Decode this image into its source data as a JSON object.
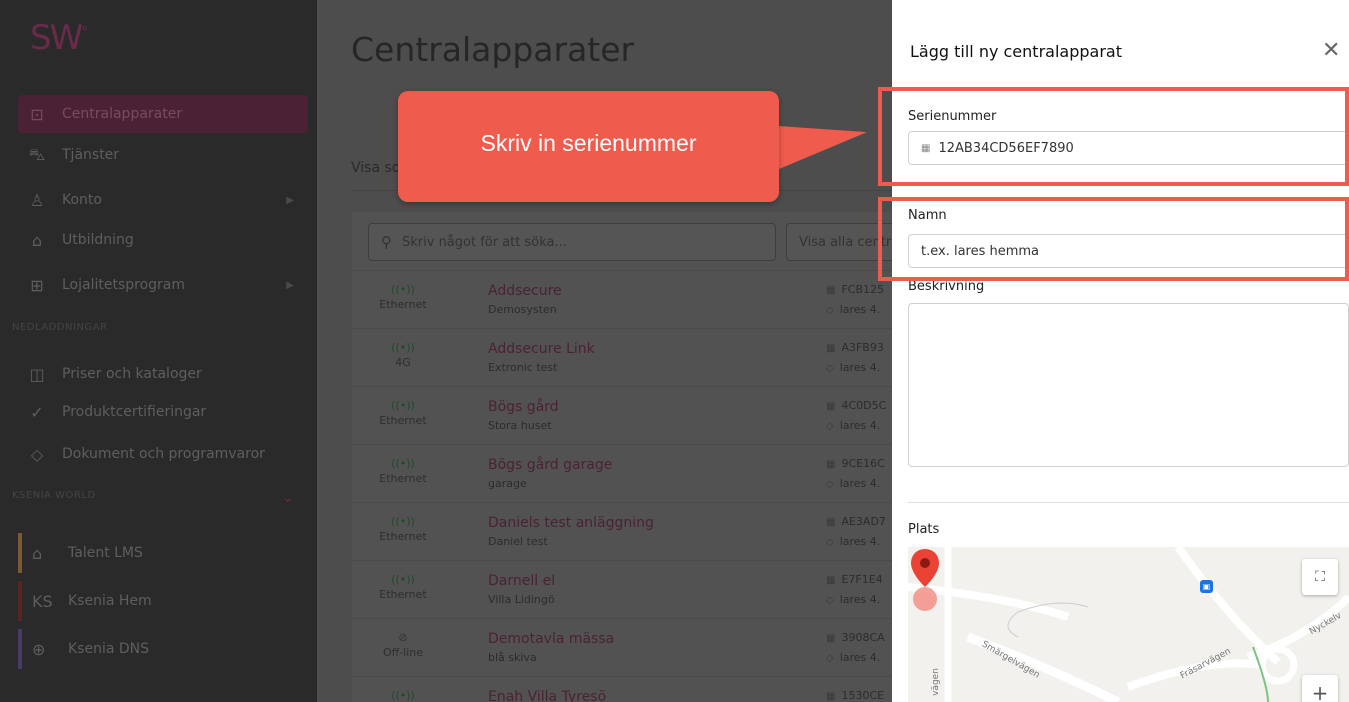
{
  "sidebar": {
    "logo": "SW",
    "logo_mark": "°",
    "items": [
      {
        "label": "Centralapparater",
        "icon": "chip-icon",
        "active": true
      },
      {
        "label": "Tjänster",
        "icon": "cart-icon"
      },
      {
        "label": "Konto",
        "icon": "user-icon",
        "has_arrow": true
      },
      {
        "label": "Utbildning",
        "icon": "graduation-cap-icon"
      },
      {
        "label": "Lojalitetsprogram",
        "icon": "gift-icon",
        "has_arrow": true
      }
    ],
    "downloads_header": "NEDLADDNINGAR",
    "downloads": [
      {
        "label": "Priser och kataloger",
        "icon": "book-icon"
      },
      {
        "label": "Produktcertifieringar",
        "icon": "check-circle-icon"
      },
      {
        "label": "Dokument och programvaror",
        "icon": "box-icon"
      }
    ],
    "world_header": "KSENIA WORLD",
    "world": [
      {
        "label": "Talent LMS",
        "icon": "graduation-cap-icon",
        "color": "#7a5a2e"
      },
      {
        "label": "Ksenia Hem",
        "icon": "ks-logo-icon",
        "icon_text": "KS",
        "color": "#5a2424"
      },
      {
        "label": "Ksenia DNS",
        "icon": "globe-icon",
        "color": "#4a3a6a"
      }
    ]
  },
  "main": {
    "title": "Centralapparater",
    "visa_label": "Visa so",
    "search_placeholder": "Skriv något för att söka...",
    "filter_label": "Visa alla centrala",
    "rows": [
      {
        "conn": "Ethernet",
        "name": "Addsecure",
        "sub": "Demosysten",
        "serial": "FCB125",
        "ver": "lares 4."
      },
      {
        "conn": "4G",
        "name": "Addsecure Link",
        "sub": "Extronic test",
        "serial": "A3FB93",
        "ver": "lares 4."
      },
      {
        "conn": "Ethernet",
        "name": "Bögs gård",
        "sub": "Stora huset",
        "serial": "4C0D5C",
        "ver": "lares 4."
      },
      {
        "conn": "Ethernet",
        "name": "Bögs gård garage",
        "sub": "garage",
        "serial": "9CE16C",
        "ver": "lares 4."
      },
      {
        "conn": "Ethernet",
        "name": "Daniels test anläggning",
        "sub": "Daniel test",
        "serial": "AE3AD7",
        "ver": "lares 4."
      },
      {
        "conn": "Ethernet",
        "name": "Darnell el",
        "sub": "Villa Lidingö",
        "serial": "E7F1E4",
        "ver": "lares 4."
      },
      {
        "conn": "Off-line",
        "name": "Demotavla mässa",
        "sub": "blå skiva",
        "serial": "3908CA",
        "ver": "lares 4.",
        "offline": true
      },
      {
        "conn": "",
        "name": "Enah Villa Tyresö",
        "sub": "",
        "serial": "1530CE",
        "ver": ""
      }
    ]
  },
  "callout": {
    "text": "Skriv in serienummer",
    "color": "#ef5b4c"
  },
  "drawer": {
    "title": "Lägg till ny centralapparat",
    "close": "✕",
    "serial_label": "Serienummer",
    "serial_value": "12AB34CD56EF7890",
    "name_label": "Namn",
    "name_placeholder": "t.ex. lares hemma",
    "description_label": "Beskrivning",
    "location_label": "Plats",
    "map": {
      "roads": [
        "Smärgelvägen",
        "Fräsarvägen",
        "Nyckelv",
        "vägen"
      ],
      "zoom_in": "+",
      "fullscreen": "⛶"
    }
  }
}
